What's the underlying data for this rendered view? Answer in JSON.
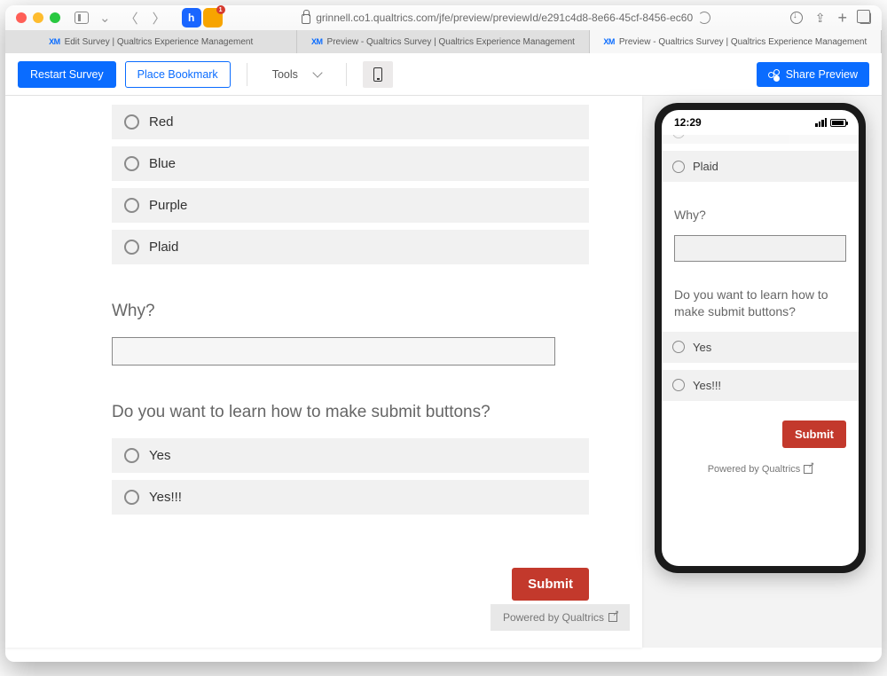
{
  "browser": {
    "url": "grinnell.co1.qualtrics.com/jfe/preview/previewId/e291c4d8-8e66-45cf-8456-ec60",
    "ext_badge": "1",
    "tabs": [
      "Edit Survey | Qualtrics Experience Management",
      "Preview - Qualtrics Survey | Qualtrics Experience Management",
      "Preview - Qualtrics Survey | Qualtrics Experience Management"
    ]
  },
  "toolbar": {
    "restart": "Restart Survey",
    "bookmark": "Place Bookmark",
    "tools": "Tools",
    "share": "Share Preview"
  },
  "survey": {
    "color_options": [
      "Red",
      "Blue",
      "Purple",
      "Plaid"
    ],
    "q_why": "Why?",
    "q_submit": "Do you want to learn how to make submit buttons?",
    "submit_options": [
      "Yes",
      "Yes!!!"
    ],
    "submit_btn": "Submit",
    "powered": "Powered by Qualtrics"
  },
  "mobile": {
    "time": "12:29",
    "cut_option": "",
    "plaid": "Plaid",
    "q_why": "Why?",
    "q_submit": "Do you want to learn how to make submit buttons?",
    "opts": [
      "Yes",
      "Yes!!!"
    ],
    "submit": "Submit",
    "powered": "Powered by Qualtrics"
  }
}
